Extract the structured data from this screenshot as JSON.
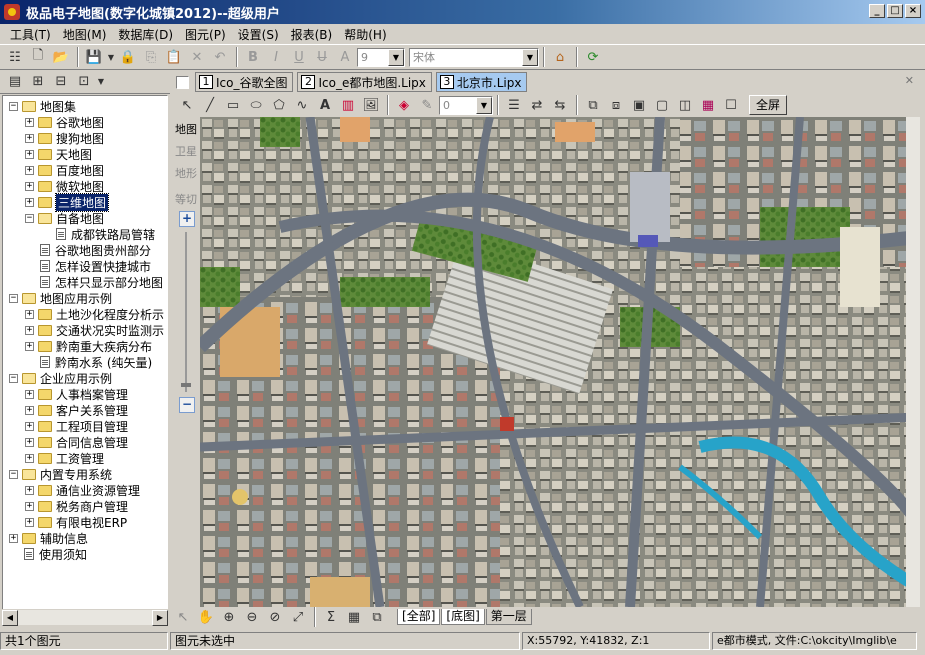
{
  "window": {
    "title": "极品电子地图(数字化城镇2012)--超级用户"
  },
  "menu": [
    "工具(T)",
    "地图(M)",
    "数据库(D)",
    "图元(P)",
    "设置(S)",
    "报表(B)",
    "帮助(H)"
  ],
  "toolbar": {
    "font_size_value": "9",
    "font_name_value": "宋体"
  },
  "tabs": [
    {
      "num": "1",
      "label": "Ico_谷歌全图"
    },
    {
      "num": "2",
      "label": "Ico_e都市地图.Lipx"
    },
    {
      "num": "3",
      "label": "北京市.Lipx"
    }
  ],
  "drawbar": {
    "line_width_value": "0",
    "fullscreen_label": "全屏"
  },
  "side_tabs": [
    "地图",
    "卫星",
    "地形",
    "等切"
  ],
  "tree": [
    {
      "label": "地图集",
      "level": 0,
      "type": "folder",
      "expander": "−"
    },
    {
      "label": "谷歌地图",
      "level": 1,
      "type": "folder",
      "expander": "+"
    },
    {
      "label": "搜狗地图",
      "level": 1,
      "type": "folder",
      "expander": "+"
    },
    {
      "label": "天地图",
      "level": 1,
      "type": "folder",
      "expander": "+"
    },
    {
      "label": "百度地图",
      "level": 1,
      "type": "folder",
      "expander": "+"
    },
    {
      "label": "微软地图",
      "level": 1,
      "type": "folder",
      "expander": "+"
    },
    {
      "label": "三维地图",
      "level": 1,
      "type": "folder",
      "expander": "+",
      "selected": true
    },
    {
      "label": "自备地图",
      "level": 1,
      "type": "folder",
      "expander": "−"
    },
    {
      "label": "成都铁路局管辖",
      "level": 2,
      "type": "doc"
    },
    {
      "label": "谷歌地图贵州部分",
      "level": 1,
      "type": "doc"
    },
    {
      "label": "怎样设置快捷城市",
      "level": 1,
      "type": "doc"
    },
    {
      "label": "怎样只显示部分地图",
      "level": 1,
      "type": "doc"
    },
    {
      "label": "地图应用示例",
      "level": 0,
      "type": "folder",
      "expander": "−"
    },
    {
      "label": "土地沙化程度分析示",
      "level": 1,
      "type": "folder",
      "expander": "+"
    },
    {
      "label": "交通状况实时监测示",
      "level": 1,
      "type": "folder",
      "expander": "+"
    },
    {
      "label": "黔南重大疾病分布",
      "level": 1,
      "type": "folder",
      "expander": "+"
    },
    {
      "label": "黔南水系 (纯矢量)",
      "level": 1,
      "type": "doc"
    },
    {
      "label": "企业应用示例",
      "level": 0,
      "type": "folder",
      "expander": "−"
    },
    {
      "label": "人事档案管理",
      "level": 1,
      "type": "folder",
      "expander": "+"
    },
    {
      "label": "客户关系管理",
      "level": 1,
      "type": "folder",
      "expander": "+"
    },
    {
      "label": "工程项目管理",
      "level": 1,
      "type": "folder",
      "expander": "+"
    },
    {
      "label": "合同信息管理",
      "level": 1,
      "type": "folder",
      "expander": "+"
    },
    {
      "label": "工资管理",
      "level": 1,
      "type": "folder",
      "expander": "+"
    },
    {
      "label": "内置专用系统",
      "level": 0,
      "type": "folder",
      "expander": "−"
    },
    {
      "label": "通信业资源管理",
      "level": 1,
      "type": "folder",
      "expander": "+"
    },
    {
      "label": "税务商户管理",
      "level": 1,
      "type": "folder",
      "expander": "+"
    },
    {
      "label": "有限电视ERP",
      "level": 1,
      "type": "folder",
      "expander": "+"
    },
    {
      "label": "辅助信息",
      "level": 0,
      "type": "folder",
      "expander": "+"
    },
    {
      "label": "使用须知",
      "level": 0,
      "type": "doc"
    }
  ],
  "sheet_tabs": [
    "全部",
    "底图",
    "第一层"
  ],
  "status": {
    "count": "共1个图元",
    "selection": "图元未选中",
    "coords": "X:55792, Y:41832, Z:1",
    "mode": "e都市模式, 文件:C:\\okcity\\Imglib\\e"
  }
}
